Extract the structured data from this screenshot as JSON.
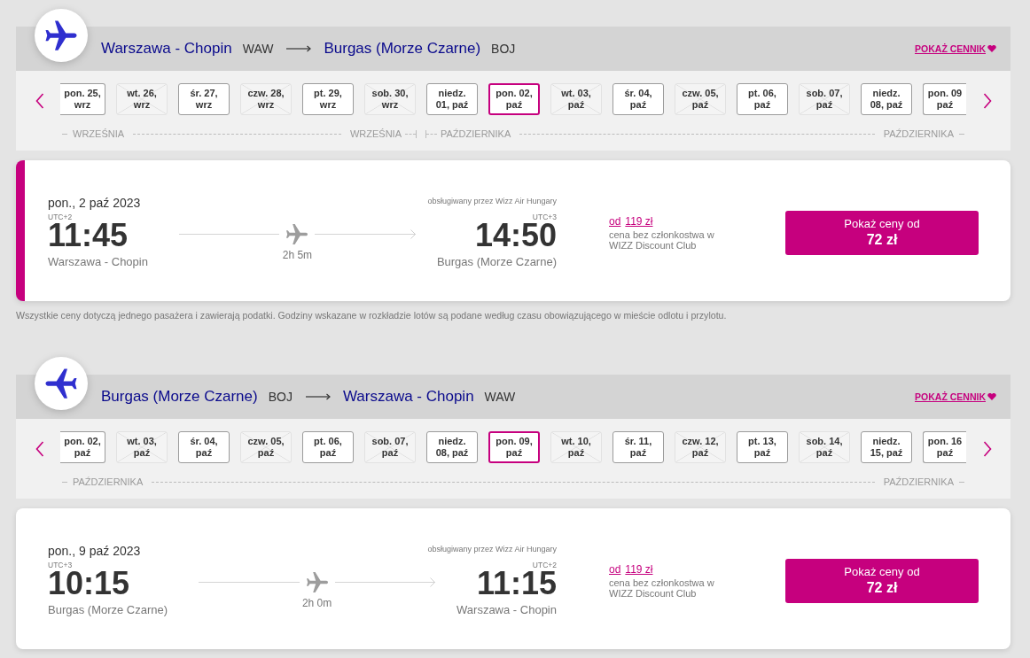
{
  "journeys": [
    {
      "kind": "outbound",
      "route": {
        "from": {
          "city": "Warszawa - Chopin",
          "code": "WAW"
        },
        "to": {
          "city": "Burgas (Morze Czarne)",
          "code": "BOJ"
        }
      },
      "price_list_link": "POKAŻ CENNIK",
      "date_strip": {
        "months": [
          {
            "label_start": "WRZEŚNIA",
            "label_end": "WRZEŚNIA",
            "days": [
              {
                "lines": [
                  "pon. 25,",
                  "wrz"
                ],
                "disabled": false,
                "selected": false
              },
              {
                "lines": [
                  "wt. 26,",
                  "wrz"
                ],
                "disabled": true,
                "selected": false
              },
              {
                "lines": [
                  "śr. 27,",
                  "wrz"
                ],
                "disabled": false,
                "selected": false
              },
              {
                "lines": [
                  "czw. 28,",
                  "wrz"
                ],
                "disabled": true,
                "selected": false
              },
              {
                "lines": [
                  "pt. 29,",
                  "wrz"
                ],
                "disabled": false,
                "selected": false
              },
              {
                "lines": [
                  "sob. 30,",
                  "wrz"
                ],
                "disabled": true,
                "selected": false
              }
            ]
          },
          {
            "label_start": "PAŹDZIERNIKA",
            "label_end": "PAŹDZIERNIKA",
            "days": [
              {
                "lines": [
                  "niedz.",
                  "01, paź"
                ],
                "disabled": false,
                "selected": false
              },
              {
                "lines": [
                  "pon. 02,",
                  "paź"
                ],
                "disabled": false,
                "selected": true
              },
              {
                "lines": [
                  "wt. 03,",
                  "paź"
                ],
                "disabled": true,
                "selected": false
              },
              {
                "lines": [
                  "śr. 04,",
                  "paź"
                ],
                "disabled": false,
                "selected": false
              },
              {
                "lines": [
                  "czw. 05,",
                  "paź"
                ],
                "disabled": true,
                "selected": false
              },
              {
                "lines": [
                  "pt. 06,",
                  "paź"
                ],
                "disabled": false,
                "selected": false
              },
              {
                "lines": [
                  "sob. 07,",
                  "paź"
                ],
                "disabled": true,
                "selected": false
              },
              {
                "lines": [
                  "niedz.",
                  "08, paź"
                ],
                "disabled": false,
                "selected": false
              },
              {
                "lines": [
                  "pon. 09",
                  "paź"
                ],
                "disabled": false,
                "selected": false
              }
            ]
          }
        ]
      },
      "flight": {
        "selected": true,
        "date": "pon., 2 paź 2023",
        "operator": "obsługiwany przez Wizz Air Hungary",
        "departure": {
          "utc": "UTC+2",
          "time": "11:45",
          "city": "Warszawa - Chopin"
        },
        "duration": "2h 5m",
        "arrival": {
          "utc": "UTC+3",
          "time": "14:50",
          "city": "Burgas (Morze Czarne)"
        },
        "from_label": "od",
        "regular_price": "119 zł",
        "price_note": "cena bez członkostwa w WIZZ Discount Club",
        "button": {
          "label": "Pokaż ceny od",
          "price": "72 zł"
        }
      },
      "footnote": "Wszystkie ceny dotyczą jednego pasażera i zawierają podatki. Godziny wskazane w rozkładzie lotów są podane według czasu obowiązującego w mieście odlotu i przylotu."
    },
    {
      "kind": "return",
      "route": {
        "from": {
          "city": "Burgas (Morze Czarne)",
          "code": "BOJ"
        },
        "to": {
          "city": "Warszawa - Chopin",
          "code": "WAW"
        }
      },
      "price_list_link": "POKAŻ CENNIK",
      "date_strip": {
        "months": [
          {
            "label_start": "PAŹDZIERNIKA",
            "label_end": "PAŹDZIERNIKA",
            "days": [
              {
                "lines": [
                  "pon. 02,",
                  "paź"
                ],
                "disabled": false,
                "selected": false
              },
              {
                "lines": [
                  "wt. 03,",
                  "paź"
                ],
                "disabled": true,
                "selected": false
              },
              {
                "lines": [
                  "śr. 04,",
                  "paź"
                ],
                "disabled": false,
                "selected": false
              },
              {
                "lines": [
                  "czw. 05,",
                  "paź"
                ],
                "disabled": true,
                "selected": false
              },
              {
                "lines": [
                  "pt. 06,",
                  "paź"
                ],
                "disabled": false,
                "selected": false
              },
              {
                "lines": [
                  "sob. 07,",
                  "paź"
                ],
                "disabled": true,
                "selected": false
              },
              {
                "lines": [
                  "niedz.",
                  "08, paź"
                ],
                "disabled": false,
                "selected": false
              },
              {
                "lines": [
                  "pon. 09,",
                  "paź"
                ],
                "disabled": false,
                "selected": true
              },
              {
                "lines": [
                  "wt. 10,",
                  "paź"
                ],
                "disabled": true,
                "selected": false
              },
              {
                "lines": [
                  "śr. 11,",
                  "paź"
                ],
                "disabled": false,
                "selected": false
              },
              {
                "lines": [
                  "czw. 12,",
                  "paź"
                ],
                "disabled": true,
                "selected": false
              },
              {
                "lines": [
                  "pt. 13,",
                  "paź"
                ],
                "disabled": false,
                "selected": false
              },
              {
                "lines": [
                  "sob. 14,",
                  "paź"
                ],
                "disabled": true,
                "selected": false
              },
              {
                "lines": [
                  "niedz.",
                  "15, paź"
                ],
                "disabled": false,
                "selected": false
              },
              {
                "lines": [
                  "pon. 16",
                  "paź"
                ],
                "disabled": false,
                "selected": false
              }
            ]
          }
        ]
      },
      "flight": {
        "selected": false,
        "date": "pon., 9 paź 2023",
        "operator": "obsługiwany przez Wizz Air Hungary",
        "departure": {
          "utc": "UTC+3",
          "time": "10:15",
          "city": "Burgas (Morze Czarne)"
        },
        "duration": "2h 0m",
        "arrival": {
          "utc": "UTC+2",
          "time": "11:15",
          "city": "Warszawa - Chopin"
        },
        "from_label": "od",
        "regular_price": "119 zł",
        "price_note": "cena bez członkostwa w WIZZ Discount Club",
        "button": {
          "label": "Pokaż ceny od",
          "price": "72 zł"
        }
      }
    }
  ]
}
